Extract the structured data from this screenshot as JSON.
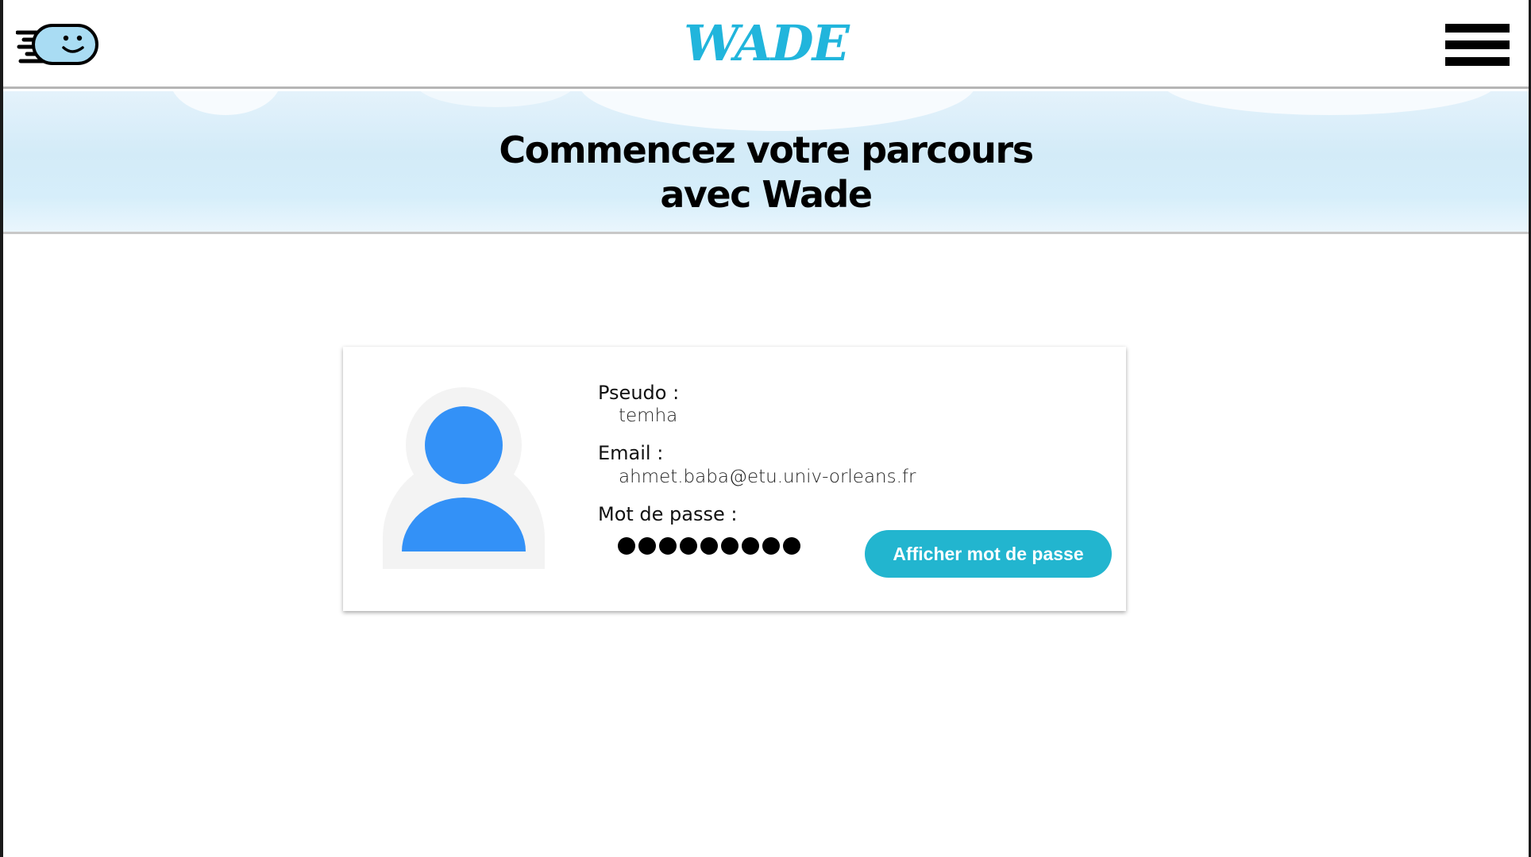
{
  "header": {
    "brand": "WADE",
    "logo_icon": "smiling-cloud-speed-icon",
    "menu_icon": "hamburger-menu-icon"
  },
  "banner": {
    "title_line1": "Commencez votre parcours",
    "title_line2": "avec Wade"
  },
  "profile": {
    "avatar_icon": "user-avatar-icon",
    "pseudo_label": "Pseudo :",
    "pseudo_value": "temha",
    "email_label": "Email :",
    "email_value": "ahmet.baba@etu.univ-orleans.fr",
    "password_label": "Mot de passe :",
    "password_mask_count": 9,
    "show_password_button": "Afficher mot de passe"
  },
  "colors": {
    "brand": "#21b5dc",
    "button": "#22b5cf",
    "avatar": "#3391f7",
    "avatar_bg": "#f3f3f3"
  }
}
